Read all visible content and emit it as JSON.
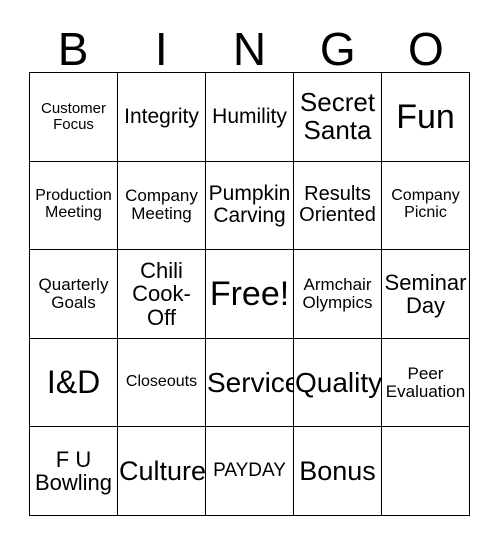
{
  "card": {
    "title": "BINGO",
    "header_letters": [
      "B",
      "I",
      "N",
      "G",
      "O"
    ],
    "free_space_label": "Free!",
    "colors": {
      "background": "#ffffff",
      "text": "#000000",
      "border": "#000000"
    },
    "grid": {
      "columns": 5,
      "rows": 5
    },
    "rows": [
      [
        {
          "label": "Customer\nFocus",
          "size": "fs-15"
        },
        {
          "label": "Integrity",
          "size": "fs-21"
        },
        {
          "label": "Humility",
          "size": "fs-21"
        },
        {
          "label": "Secret\nSanta",
          "size": "fs-26"
        },
        {
          "label": "Fun",
          "size": "fs-34"
        }
      ],
      [
        {
          "label": "Production\nMeeting",
          "size": "fs-16"
        },
        {
          "label": "Company\nMeeting",
          "size": "fs-17"
        },
        {
          "label": "Pumpkin\nCarving",
          "size": "fs-21"
        },
        {
          "label": "Results\nOriented",
          "size": "fs-20"
        },
        {
          "label": "Company\nPicnic",
          "size": "fs-16"
        }
      ],
      [
        {
          "label": "Quarterly\nGoals",
          "size": "fs-17"
        },
        {
          "label": "Chili\nCook-\nOff",
          "size": "fs-22"
        },
        {
          "label": "Free!",
          "size": "fs-34"
        },
        {
          "label": "Armchair\nOlympics",
          "size": "fs-17"
        },
        {
          "label": "Seminar\nDay",
          "size": "fs-22"
        }
      ],
      [
        {
          "label": "I&D",
          "size": "fs-32"
        },
        {
          "label": "Closeouts",
          "size": "fs-16"
        },
        {
          "label": "Service",
          "size": "fs-28"
        },
        {
          "label": "Quality",
          "size": "fs-28"
        },
        {
          "label": "Peer\nEvaluation",
          "size": "fs-17"
        }
      ],
      [
        {
          "label": "F U\nBowling",
          "size": "fs-22"
        },
        {
          "label": "Culture",
          "size": "fs-27"
        },
        {
          "label": "PAYDAY",
          "size": "fs-19"
        },
        {
          "label": "Bonus",
          "size": "fs-27"
        },
        {
          "label": "",
          "size": "fs-20"
        }
      ]
    ]
  }
}
